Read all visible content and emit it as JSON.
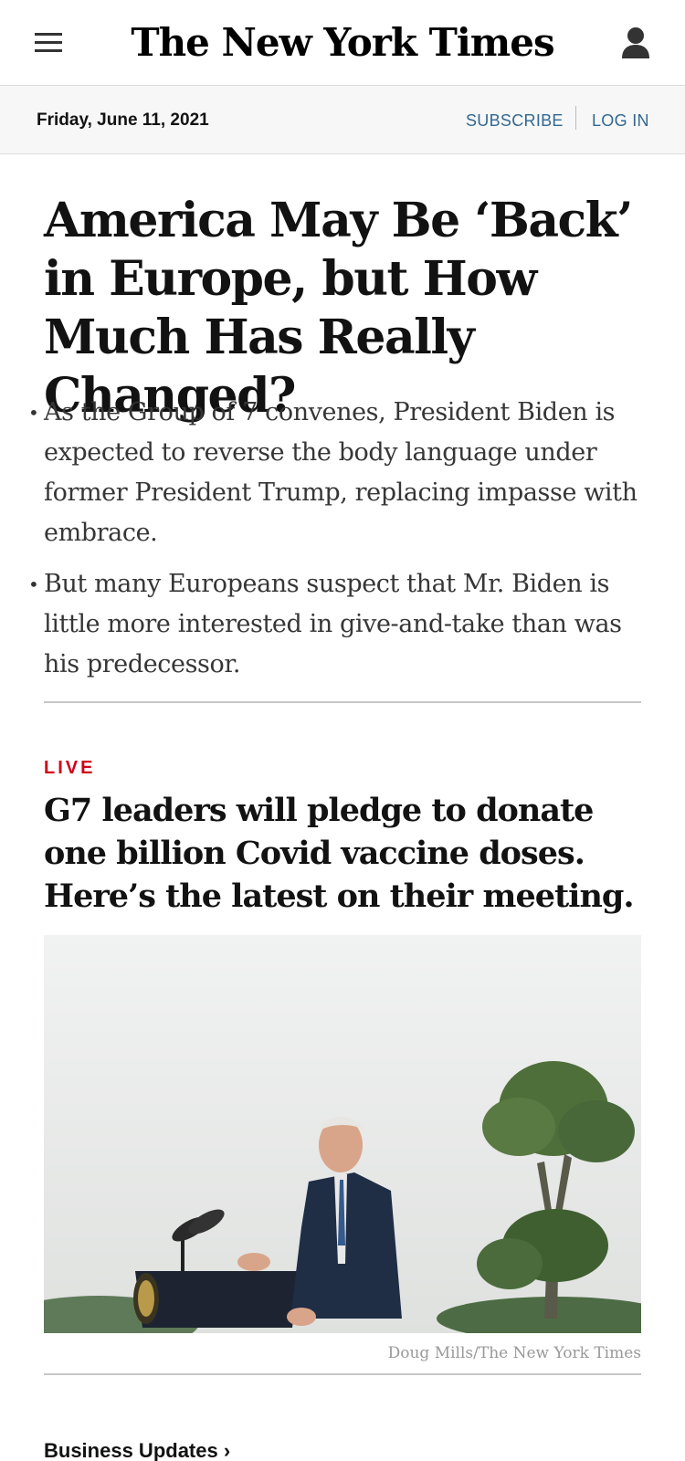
{
  "masthead": {
    "logo_text": "The New York Times",
    "menu_icon": "hamburger-menu-icon",
    "account_icon": "user-account-icon"
  },
  "datebar": {
    "date": "Friday, June 11, 2021",
    "subscribe_label": "SUBSCRIBE",
    "login_label": "LOG IN"
  },
  "lead_story": {
    "headline": "America May Be ‘Back’ in Europe, but How Much Has Really Changed?",
    "summary": [
      "As the Group of 7 convenes, President Biden is expected to reverse the body language under former President Trump, replacing impasse with embrace.",
      "But many Europeans suspect that Mr. Biden is little more interested in give-and-take than was his predecessor."
    ]
  },
  "live_story": {
    "label": "LIVE",
    "headline": "G7 leaders will pledge to donate one billion Covid vaccine doses. Here’s the latest on their meeting.",
    "photo_credit": "Doug Mills/The New York Times"
  },
  "next_section": {
    "label": "Business Updates ›"
  },
  "colors": {
    "link_blue": "#326891",
    "live_red": "#d0021b",
    "text": "#121212"
  }
}
